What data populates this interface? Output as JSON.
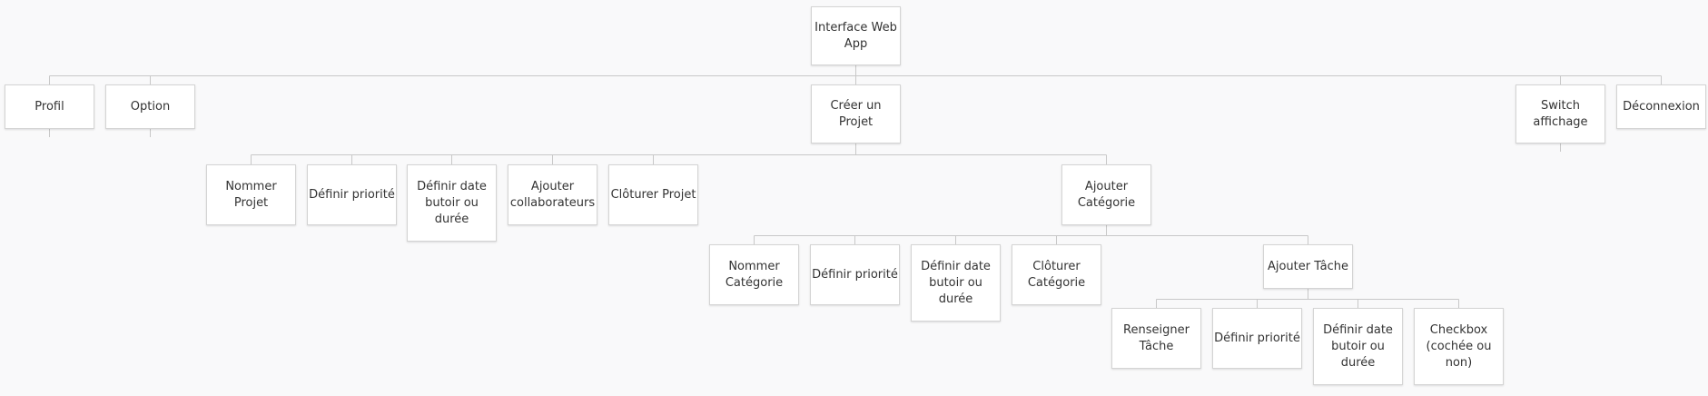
{
  "diagram": {
    "type": "tree",
    "root": {
      "label": "Interface Web App",
      "children": [
        {
          "label": "Profil"
        },
        {
          "label": "Option"
        },
        {
          "label": "Créer un Projet",
          "children": [
            {
              "label": "Nommer Projet"
            },
            {
              "label": "Définir priorité"
            },
            {
              "label": "Définir date butoir ou durée"
            },
            {
              "label": "Ajouter collaborateurs"
            },
            {
              "label": "Clôturer Projet"
            },
            {
              "label": "Ajouter Catégorie",
              "children": [
                {
                  "label": "Nommer Catégorie"
                },
                {
                  "label": "Définir priorité"
                },
                {
                  "label": "Définir date butoir ou durée"
                },
                {
                  "label": "Clôturer Catégorie"
                },
                {
                  "label": "Ajouter Tâche",
                  "children": [
                    {
                      "label": "Renseigner Tâche"
                    },
                    {
                      "label": "Définir priorité"
                    },
                    {
                      "label": "Définir date butoir ou durée"
                    },
                    {
                      "label": "Checkbox (cochée ou non)"
                    }
                  ]
                }
              ]
            }
          ]
        },
        {
          "label": "Switch affichage"
        },
        {
          "label": "Déconnexion"
        }
      ]
    }
  },
  "colors": {
    "background": "#f9f9fa",
    "node_fill": "#ffffff",
    "node_border": "#d4d4d4",
    "connector": "#c8c8c8",
    "text": "#333333"
  }
}
